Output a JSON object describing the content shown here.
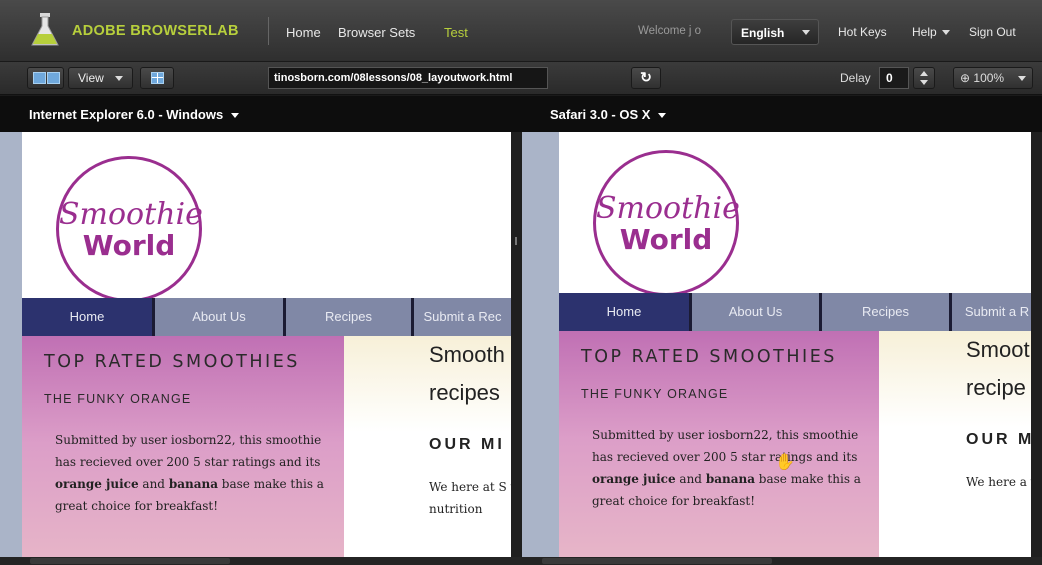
{
  "app": {
    "brand": "ADOBE BROWSERLAB",
    "nav": {
      "home": "Home",
      "browser_sets": "Browser Sets",
      "test": "Test"
    },
    "welcome": "Welcome j o",
    "language": "English",
    "hotkeys": "Hot Keys",
    "help": "Help",
    "signout": "Sign Out",
    "accent_color": "#b7cf3c"
  },
  "toolbar": {
    "view_label": "View",
    "url": "tinosborn.com/08lessons/08_layoutwork.html",
    "delay_label": "Delay",
    "delay_value": "0",
    "zoom": "100%"
  },
  "panes": [
    {
      "browser": "Internet Explorer 6.0 - Windows"
    },
    {
      "browser": "Safari 3.0 - OS X"
    }
  ],
  "site": {
    "logo_top": "Smoothie",
    "logo_bottom": "World",
    "nav": [
      "Home",
      "About Us",
      "Recipes",
      "Submit a Rec",
      "Submit a R"
    ],
    "top_rated": "TOP RATED SMOOTHIES",
    "funky": "THE FUNKY ORANGE",
    "desc_1": "Submitted by user iosborn22, this smoothie has recieved over 200 5 star ratings and its ",
    "desc_bold_1": "orange juice",
    "desc_2": " and ",
    "desc_bold_2": "banana",
    "desc_3": " base make this a great choice for breakfast!",
    "smooth_left": "Smooth",
    "smooth_right": "Smoot",
    "recipes_left": "recipes",
    "recipes_right": "recipe",
    "mission_left": "OUR MI",
    "mission_right": "OUR M",
    "we_here_left": "We here at S your life. Wh the nutrition",
    "we_here_right": "We here a your life. V the nutriti",
    "brand_purple": "#9a2e8f",
    "nav_active": "#2c326e",
    "nav_bg": "#8088a6"
  }
}
